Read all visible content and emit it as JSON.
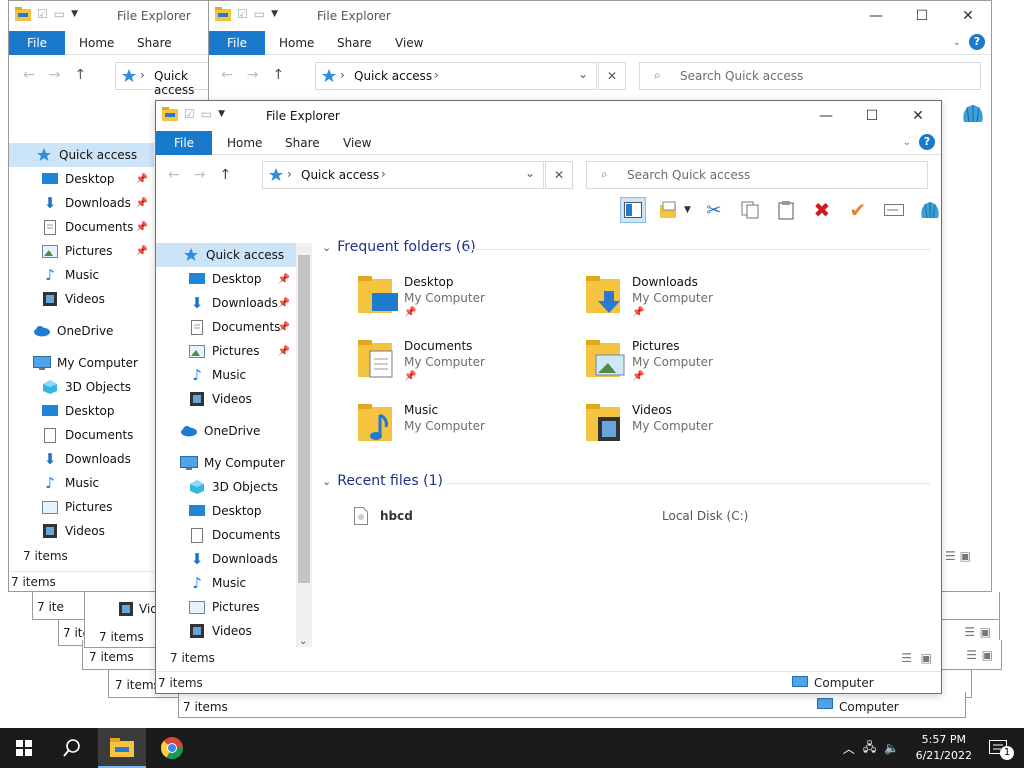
{
  "app_title": "File Explorer",
  "ribbon": {
    "file": "File",
    "home": "Home",
    "share": "Share",
    "view": "View",
    "help": "?"
  },
  "address": {
    "location": "Quick access",
    "search_placeholder": "Search Quick access"
  },
  "nav": {
    "quick_access": "Quick access",
    "desktop": "Desktop",
    "downloads": "Downloads",
    "documents": "Documents",
    "pictures": "Pictures",
    "music": "Music",
    "videos": "Videos",
    "onedrive": "OneDrive",
    "my_computer": "My Computer",
    "objects_3d": "3D Objects"
  },
  "content": {
    "frequent_header": "Frequent folders (6)",
    "recent_header": "Recent files (1)",
    "folders": [
      {
        "name": "Desktop",
        "location": "My Computer"
      },
      {
        "name": "Downloads",
        "location": "My Computer"
      },
      {
        "name": "Documents",
        "location": "My Computer"
      },
      {
        "name": "Pictures",
        "location": "My Computer"
      },
      {
        "name": "Music",
        "location": "My Computer"
      },
      {
        "name": "Videos",
        "location": "My Computer"
      }
    ],
    "recent": [
      {
        "name": "hbcd",
        "location": "Local Disk (C:)"
      }
    ]
  },
  "status": {
    "items": "7 items",
    "computer": "Computer",
    "partial_home": "ome",
    "partial_video": "Vid",
    "partial_items": "7 ite"
  },
  "taskbar": {
    "time": "5:57 PM",
    "date": "6/21/2022",
    "notification_count": "1"
  },
  "colors": {
    "accent": "#1979ca",
    "folder": "#f4c33f",
    "selection": "#cce4f7",
    "header_text": "#1e3287"
  },
  "icons": {
    "windows": "windows-logo-icon",
    "search": "magnifier-icon",
    "explorer": "folder-icon",
    "chrome": "chrome-icon",
    "quick_access": "star-icon",
    "pin": "pin-icon"
  }
}
